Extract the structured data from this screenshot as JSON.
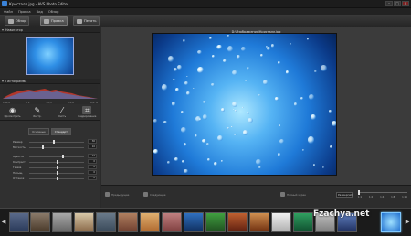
{
  "window": {
    "title": "Кристалл.jpg - AVS Photo Editor"
  },
  "menu": [
    "Файл",
    "Правка",
    "Вид",
    "Обзор"
  ],
  "toolbar": {
    "obzor": "Обзор",
    "pravka": "Правка",
    "pechat": "Печать"
  },
  "left": {
    "navigator_label": "Навигатор",
    "histogram_label": "Гистограмма",
    "hist_values": [
      "100,0",
      "F1",
      "F2,3",
      "F2,0",
      "0,0 %"
    ],
    "tools": [
      {
        "label": "Просмотреть",
        "icon": "eye-icon"
      },
      {
        "label": "Инстр.",
        "icon": "brush-icon"
      },
      {
        "label": "Кисть",
        "icon": "pen-icon"
      },
      {
        "label": "Кадрирование",
        "icon": "crop-icon"
      }
    ],
    "subtabs": [
      "Основные",
      "Стандарт"
    ],
    "sliders": [
      {
        "label": "Размер",
        "value": "30"
      },
      {
        "label": "Мягкость",
        "value": "10"
      },
      {
        "label": "Яркость",
        "value": "22"
      },
      {
        "label": "Контраст",
        "value": "0"
      },
      {
        "label": "Гамма",
        "value": "0"
      },
      {
        "label": "Насыщ.",
        "value": "0"
      },
      {
        "label": "Оттенок",
        "value": "0"
      }
    ]
  },
  "main": {
    "path": "D:\\Изображения\\Кристалл.jpg",
    "bottom": {
      "prev": "Предыдущее",
      "next": "Следующее",
      "fullscreen": "Полный экран",
      "zoom_value": "Размер(Ш)"
    },
    "zoom_ticks": [
      "1:1",
      "1:2",
      "1:4",
      "1:8",
      "1:16"
    ]
  },
  "watermark": "Fzachya.net",
  "colors": {
    "accent": "#7fc8ff",
    "panel": "#303030"
  }
}
